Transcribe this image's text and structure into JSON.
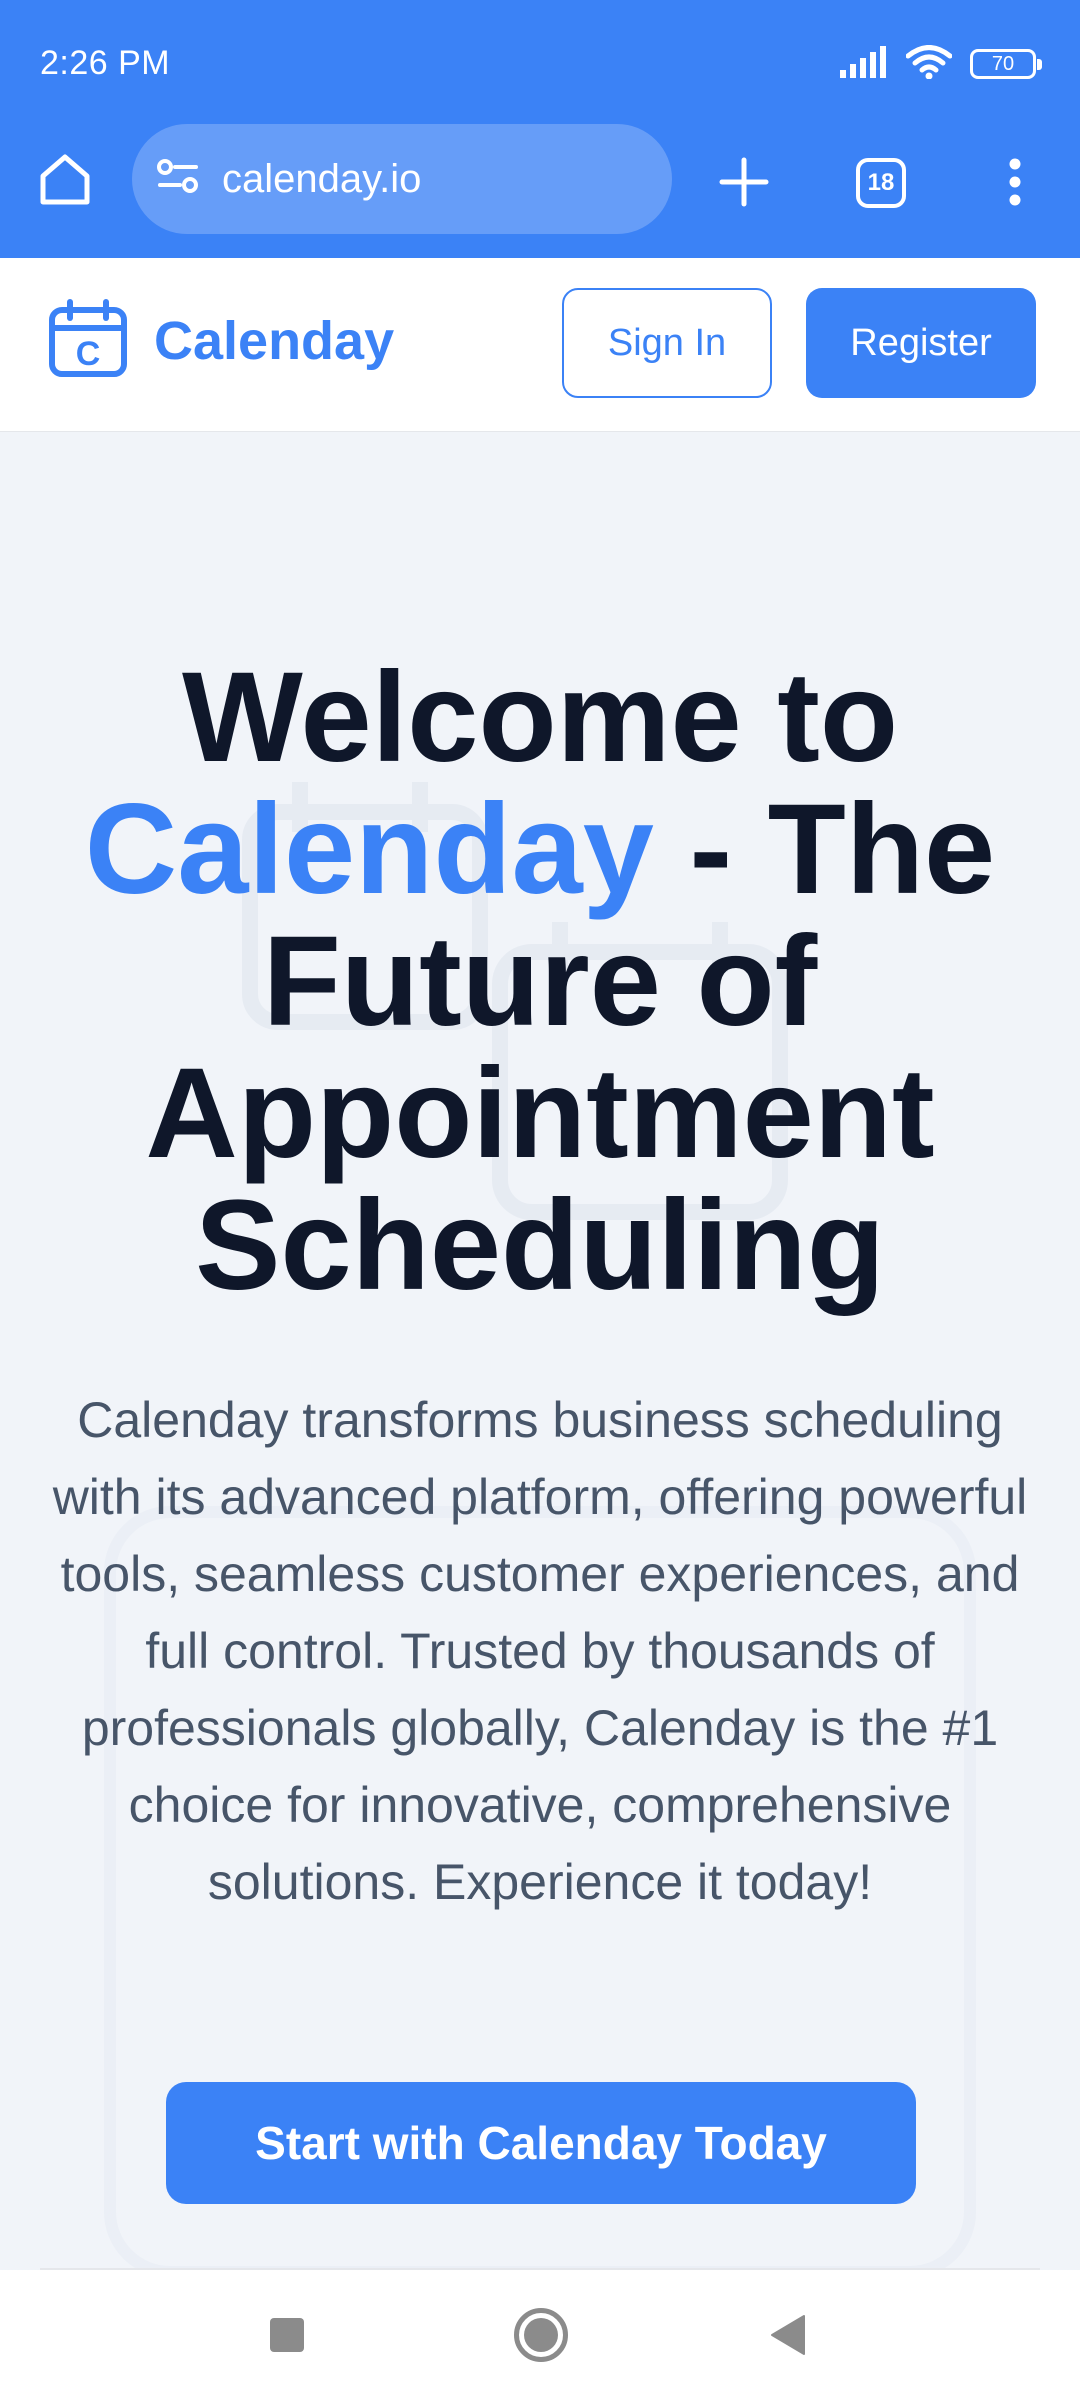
{
  "status_bar": {
    "time": "2:26 PM",
    "battery": "70",
    "icons": [
      "signal-icon",
      "wifi-icon",
      "battery-icon"
    ]
  },
  "browser": {
    "url": "calenday.io",
    "tab_count": "18",
    "icons": [
      "home-icon",
      "site-settings-icon",
      "new-tab-icon",
      "tabs-icon",
      "more-menu-icon"
    ]
  },
  "header": {
    "logo_letter": "C",
    "logo_text": "Calenday",
    "sign_in_label": "Sign In",
    "register_label": "Register"
  },
  "hero": {
    "title_part1": "Welcome to",
    "title_brand": "Calenday",
    "title_part2": "- The Future of Appointment Scheduling",
    "description": "Calenday transforms business scheduling with its advanced platform, offering powerful tools, seamless customer experiences, and full control. Trusted by thousands of professionals globally, Calenday is the #1 choice for innovative, comprehensive solutions. Experience it today!",
    "cta_label": "Start with Calenday Today"
  },
  "colors": {
    "brand": "#3b82f6",
    "heading": "#0f172a",
    "body_text": "#475569",
    "background": "#f1f4f9"
  },
  "nav_bar": {
    "icons": [
      "recents-icon",
      "home-circle-icon",
      "back-icon"
    ]
  }
}
